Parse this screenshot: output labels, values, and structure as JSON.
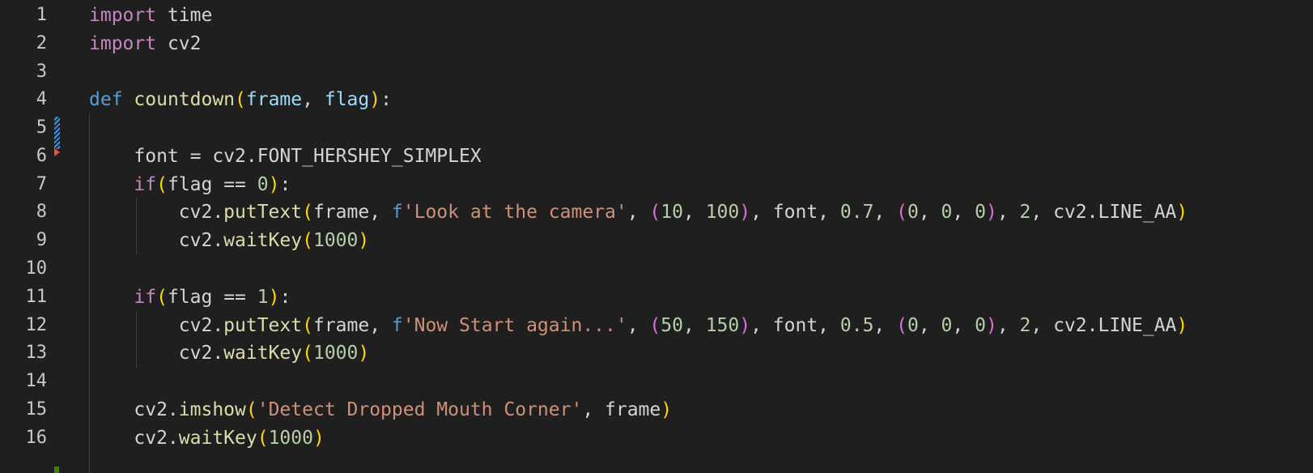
{
  "editor": {
    "line_numbers": [
      "1",
      "2",
      "3",
      "4",
      "5",
      "6",
      "7",
      "8",
      "9",
      "10",
      "11",
      "12",
      "13",
      "14",
      "15",
      "16"
    ],
    "code": {
      "l1_kw": "import",
      "l1_rest": " time",
      "l2_kw": "import",
      "l2_rest": " cv2",
      "l4_def": "def",
      "l4_name": "countdown",
      "l4_open": "(",
      "l4_p1": "frame",
      "l4_comma": ", ",
      "l4_p2": "flag",
      "l4_close": ")",
      "l4_colon": ":",
      "l6_text": "    font = cv2.FONT_HERSHEY_SIMPLEX",
      "l7_indent": "    ",
      "l7_if": "if",
      "l7_open": "(",
      "l7_cond": "flag == ",
      "l7_num": "0",
      "l7_close": ")",
      "l7_colon": ":",
      "l8_pre": "        cv2.",
      "l8_fn": "putText",
      "l8_open": "(",
      "l8_a": "frame, ",
      "l8_f": "f",
      "l8_str": "'Look at the camera'",
      "l8_c1": ", ",
      "l8_t1o": "(",
      "l8_n1": "10",
      "l8_c2": ", ",
      "l8_n2": "100",
      "l8_t1c": ")",
      "l8_mid": ", font, ",
      "l8_n3": "0.7",
      "l8_c3": ", ",
      "l8_t2o": "(",
      "l8_n4": "0",
      "l8_c4": ", ",
      "l8_n5": "0",
      "l8_c5": ", ",
      "l8_n6": "0",
      "l8_t2c": ")",
      "l8_c6": ", ",
      "l8_n7": "2",
      "l8_end": ", cv2.LINE_AA",
      "l8_close": ")",
      "l9_pre": "        cv2.",
      "l9_fn": "waitKey",
      "l9_open": "(",
      "l9_num": "1000",
      "l9_close": ")",
      "l11_indent": "    ",
      "l11_if": "if",
      "l11_open": "(",
      "l11_cond": "flag == ",
      "l11_num": "1",
      "l11_close": ")",
      "l11_colon": ":",
      "l12_pre": "        cv2.",
      "l12_fn": "putText",
      "l12_open": "(",
      "l12_a": "frame, ",
      "l12_f": "f",
      "l12_str": "'Now Start again...'",
      "l12_c1": ", ",
      "l12_t1o": "(",
      "l12_n1": "50",
      "l12_c2": ", ",
      "l12_n2": "150",
      "l12_t1c": ")",
      "l12_mid": ", font, ",
      "l12_n3": "0.5",
      "l12_c3": ", ",
      "l12_t2o": "(",
      "l12_n4": "0",
      "l12_c4": ", ",
      "l12_n5": "0",
      "l12_c5": ", ",
      "l12_n6": "0",
      "l12_t2c": ")",
      "l12_c6": ", ",
      "l12_n7": "2",
      "l12_end": ", cv2.LINE_AA",
      "l12_close": ")",
      "l13_pre": "        cv2.",
      "l13_fn": "waitKey",
      "l13_open": "(",
      "l13_num": "1000",
      "l13_close": ")",
      "l15_pre": "    cv2.",
      "l15_fn": "imshow",
      "l15_open": "(",
      "l15_str": "'Detect Dropped Mouth Corner'",
      "l15_rest": ", frame",
      "l15_close": ")",
      "l16_pre": "    cv2.",
      "l16_fn": "waitKey",
      "l16_open": "(",
      "l16_num": "1000",
      "l16_close": ")"
    }
  },
  "colors": {
    "background": "#1f1f1f",
    "keyword": "#c586c0",
    "def": "#569cd6",
    "function": "#dcdcaa",
    "parameter": "#9cdcfe",
    "number": "#b5cea8",
    "string": "#ce9178",
    "bracket_1": "#ffd700",
    "bracket_2": "#da70d6",
    "diff_modified": "#3794ff",
    "diff_deleted": "#f14c4c",
    "diff_added": "#487e02"
  }
}
